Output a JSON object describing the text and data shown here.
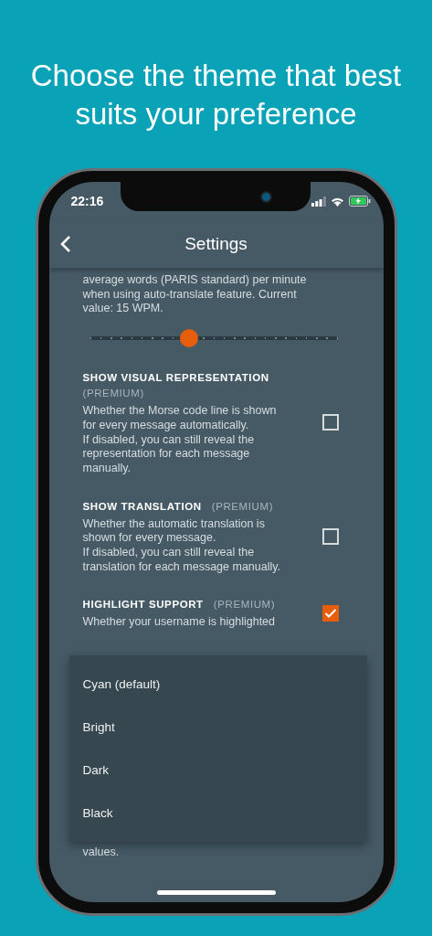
{
  "headline": "Choose the theme that best suits your preference",
  "status_bar": {
    "time": "22:16"
  },
  "app_bar": {
    "title": "Settings"
  },
  "speed_setting": {
    "description_lines": [
      "average words (PARIS standard) per minute",
      "when using auto-translate feature. Current",
      "value: 15 WPM."
    ],
    "level": 0.4
  },
  "settings": [
    {
      "title": "SHOW VISUAL REPRESENTATION",
      "tag": "(PREMIUM)",
      "description_lines": [
        "Whether the Morse code line is shown",
        "for every message automatically.",
        "If disabled, you can still reveal the",
        "representation for each message",
        "manually."
      ],
      "checked": false
    },
    {
      "title": "SHOW TRANSLATION",
      "tag": "(PREMIUM)",
      "description_lines": [
        "Whether the automatic translation is",
        "shown for every message.",
        "If disabled, you can still reveal the",
        "translation for each message manually."
      ],
      "checked": false
    },
    {
      "title": "HIGHLIGHT SUPPORT",
      "tag": "(PREMIUM)",
      "description_lines": [
        "Whether your username is highlighted"
      ],
      "checked": true
    }
  ],
  "menu": {
    "items": [
      {
        "label": "Cyan (default)"
      },
      {
        "label": "Bright"
      },
      {
        "label": "Dark"
      },
      {
        "label": "Black"
      }
    ]
  },
  "trailing_text": "values."
}
